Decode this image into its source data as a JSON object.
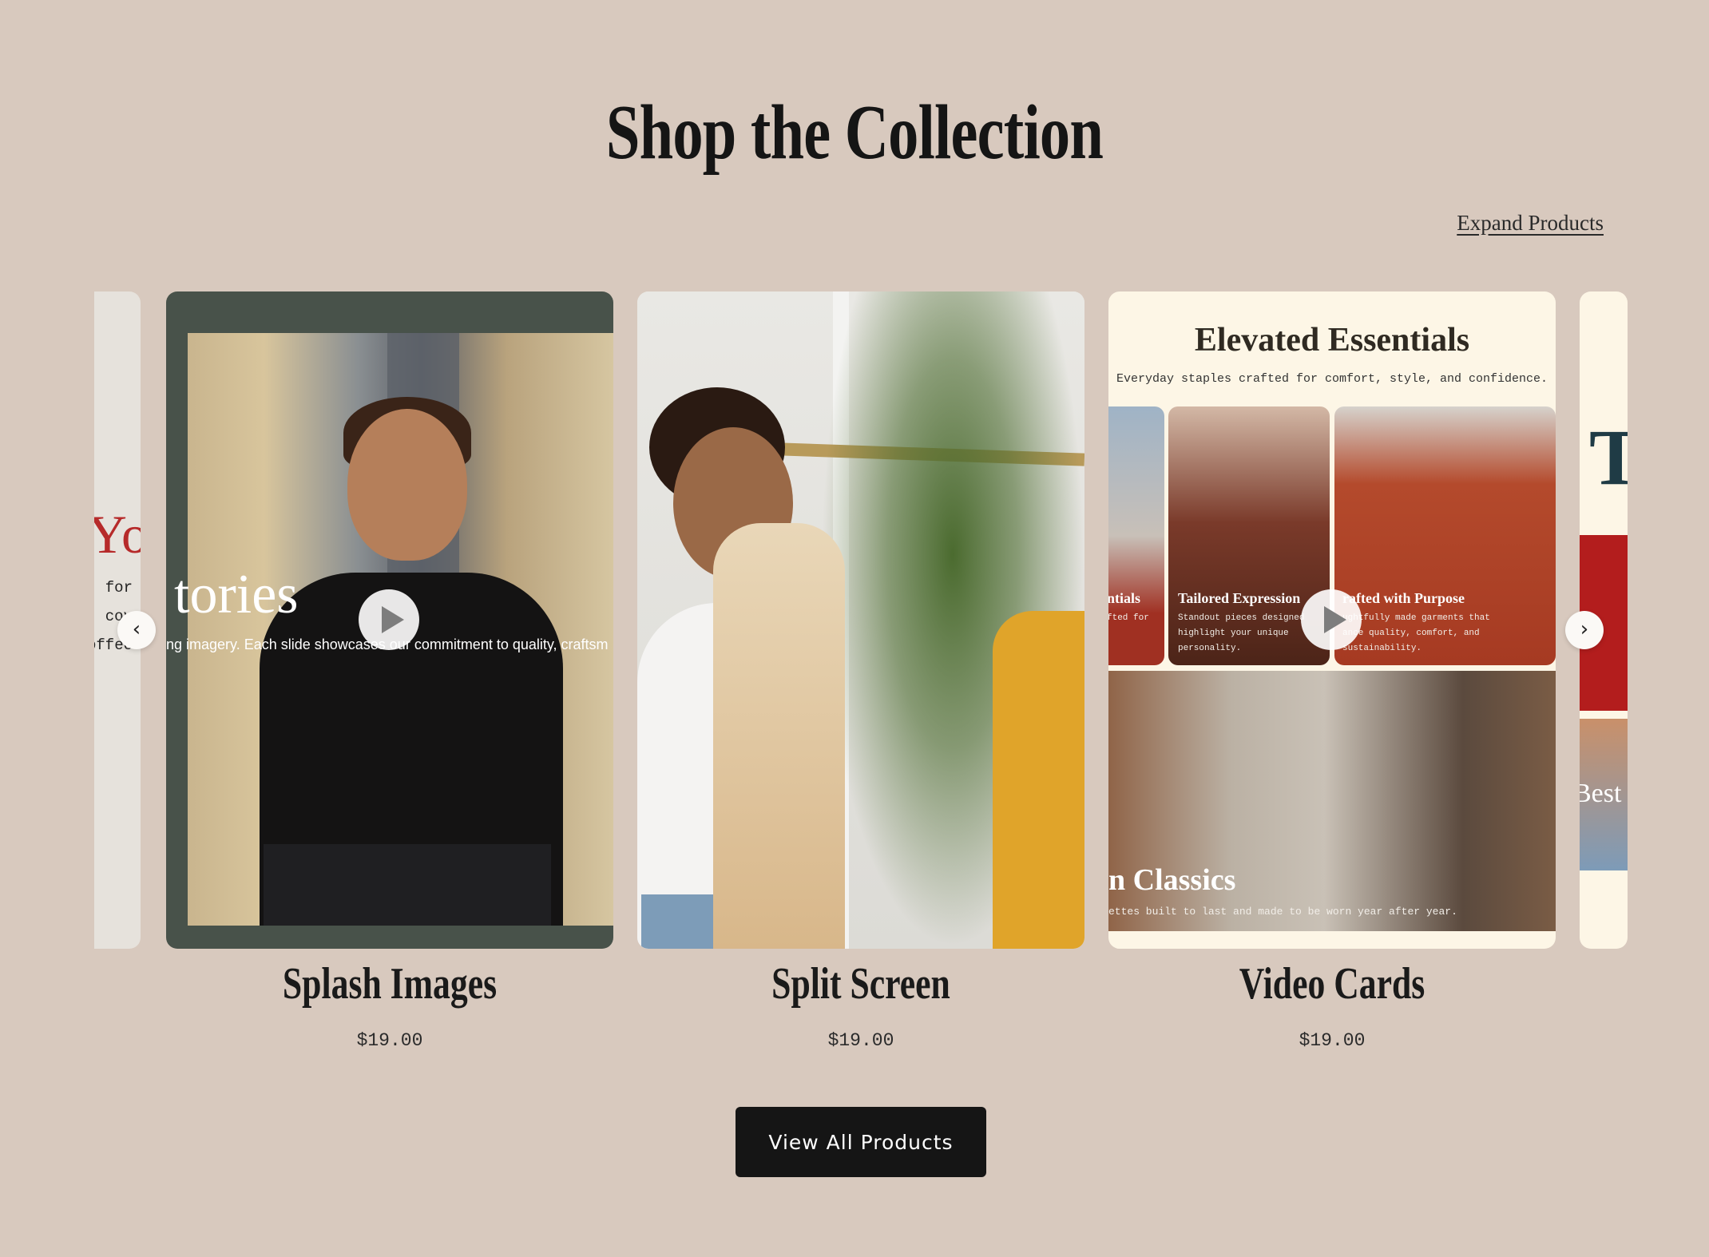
{
  "section": {
    "title": "Shop the Collection",
    "expand_link": "Expand Products"
  },
  "peek_left": {
    "heading_fragment": "Yo",
    "lines": [
      "for",
      "cov",
      "offee"
    ]
  },
  "products": [
    {
      "name": "Splash Images",
      "price": "$19.00",
      "preview": {
        "overlay_title": "tories",
        "overlay_subtitle": "ng imagery. Each slide showcases our commitment to quality, craftsm"
      }
    },
    {
      "name": "Split Screen",
      "price": "$19.00"
    },
    {
      "name": "Video Cards",
      "price": "$19.00",
      "preview": {
        "heading": "Elevated Essentials",
        "subheading": "Everyday staples crafted for comfort, style, and confidence.",
        "tiles": [
          {
            "title": "ntials",
            "body": "fted for"
          },
          {
            "title": "Tailored Expression",
            "body_lines": [
              "Standout pieces designed",
              "highlight your unique",
              "personality."
            ]
          },
          {
            "title": "rafted with Purpose",
            "body_lines": [
              "ughtfully made garments that",
              "ance quality, comfort, and",
              "sustainability."
            ]
          },
          {
            "title": "n Classics",
            "body": "ettes built to last and made to be worn year after year."
          }
        ]
      }
    }
  ],
  "peek_right": {
    "heading_fragment": "T",
    "label_fragment": "Best"
  },
  "carousel": {
    "prev_icon": "chevron-left-icon",
    "next_icon": "chevron-right-icon",
    "prev_glyph": "‹",
    "next_glyph": "›"
  },
  "cta": {
    "label": "View All Products"
  },
  "colors": {
    "background": "#d8c9be",
    "button": "#151515",
    "splash_frame": "#48524a",
    "video_card_bg": "#fdf6e6"
  }
}
